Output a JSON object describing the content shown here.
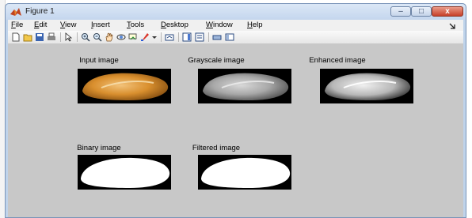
{
  "edge": {
    "char": "n"
  },
  "window": {
    "title": "Figure 1",
    "controls": {
      "minimize": "–",
      "maximize": "□",
      "close": "x"
    }
  },
  "menu": {
    "items": [
      {
        "label": "File",
        "hotkey": "F"
      },
      {
        "label": "Edit",
        "hotkey": "E"
      },
      {
        "label": "View",
        "hotkey": "V"
      },
      {
        "label": "Insert",
        "hotkey": "I"
      },
      {
        "label": "Tools",
        "hotkey": "T"
      },
      {
        "label": "Desktop",
        "hotkey": "D"
      },
      {
        "label": "Window",
        "hotkey": "W"
      },
      {
        "label": "Help",
        "hotkey": "H"
      }
    ],
    "overflow_icon": "dock-arrow-icon"
  },
  "toolbar": {
    "icons": [
      "new-figure-icon",
      "open-file-icon",
      "save-icon",
      "print-icon",
      "edit-plot-icon",
      "zoom-in-icon",
      "zoom-out-icon",
      "pan-icon",
      "rotate-3d-icon",
      "data-cursor-icon",
      "brush-icon",
      "link-plot-icon",
      "colorbar-icon",
      "legend-icon",
      "hide-plot-tools-icon",
      "show-plot-tools-icon"
    ]
  },
  "figure": {
    "panels": [
      {
        "title": "Input image"
      },
      {
        "title": "Grayscale image"
      },
      {
        "title": "Enhanced image"
      },
      {
        "title": "Binary image"
      },
      {
        "title": "Filtered image"
      }
    ],
    "colors": {
      "background": "#c8c8c8",
      "input_seed": "#d89a3a",
      "black": "#000000"
    }
  }
}
